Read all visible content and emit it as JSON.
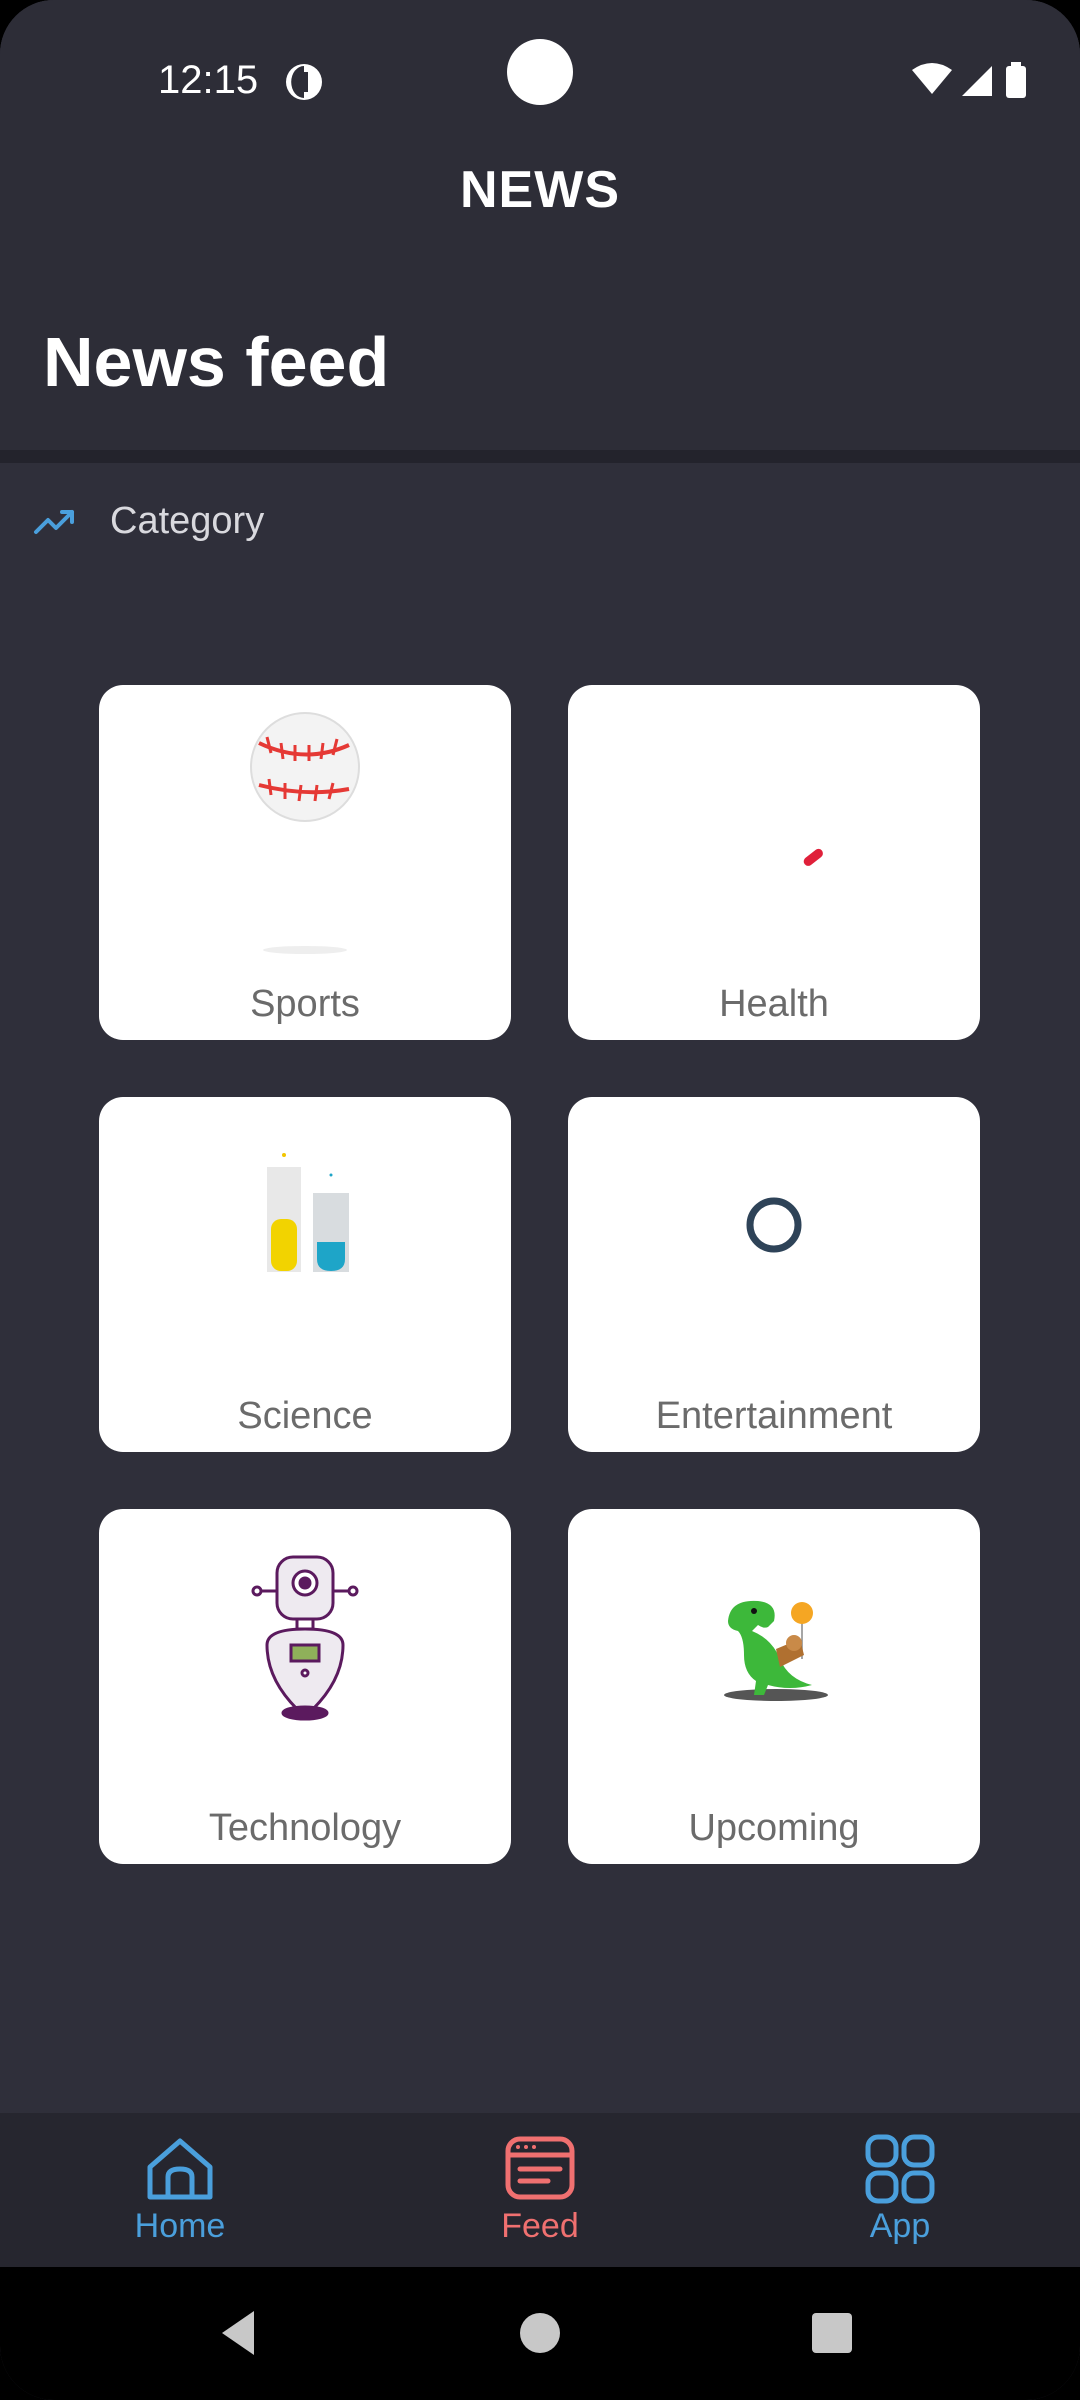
{
  "status": {
    "time": "12:15"
  },
  "app": {
    "title": "NEWS"
  },
  "page": {
    "title": "News feed"
  },
  "section": {
    "label": "Category",
    "icon": "trending-up-icon"
  },
  "categories": [
    {
      "label": "Sports",
      "icon": "baseball-icon"
    },
    {
      "label": "Health",
      "icon": "pill-icon"
    },
    {
      "label": "Science",
      "icon": "test-tubes-icon"
    },
    {
      "label": "Entertainment",
      "icon": "ring-icon"
    },
    {
      "label": "Technology",
      "icon": "robot-icon"
    },
    {
      "label": "Upcoming",
      "icon": "dinosaur-icon"
    }
  ],
  "nav": {
    "home": "Home",
    "feed": "Feed",
    "app": "App"
  },
  "colors": {
    "background": "#2f2f3a",
    "accent_blue": "#4a9fdc",
    "accent_red": "#f07070",
    "card": "#ffffff"
  }
}
